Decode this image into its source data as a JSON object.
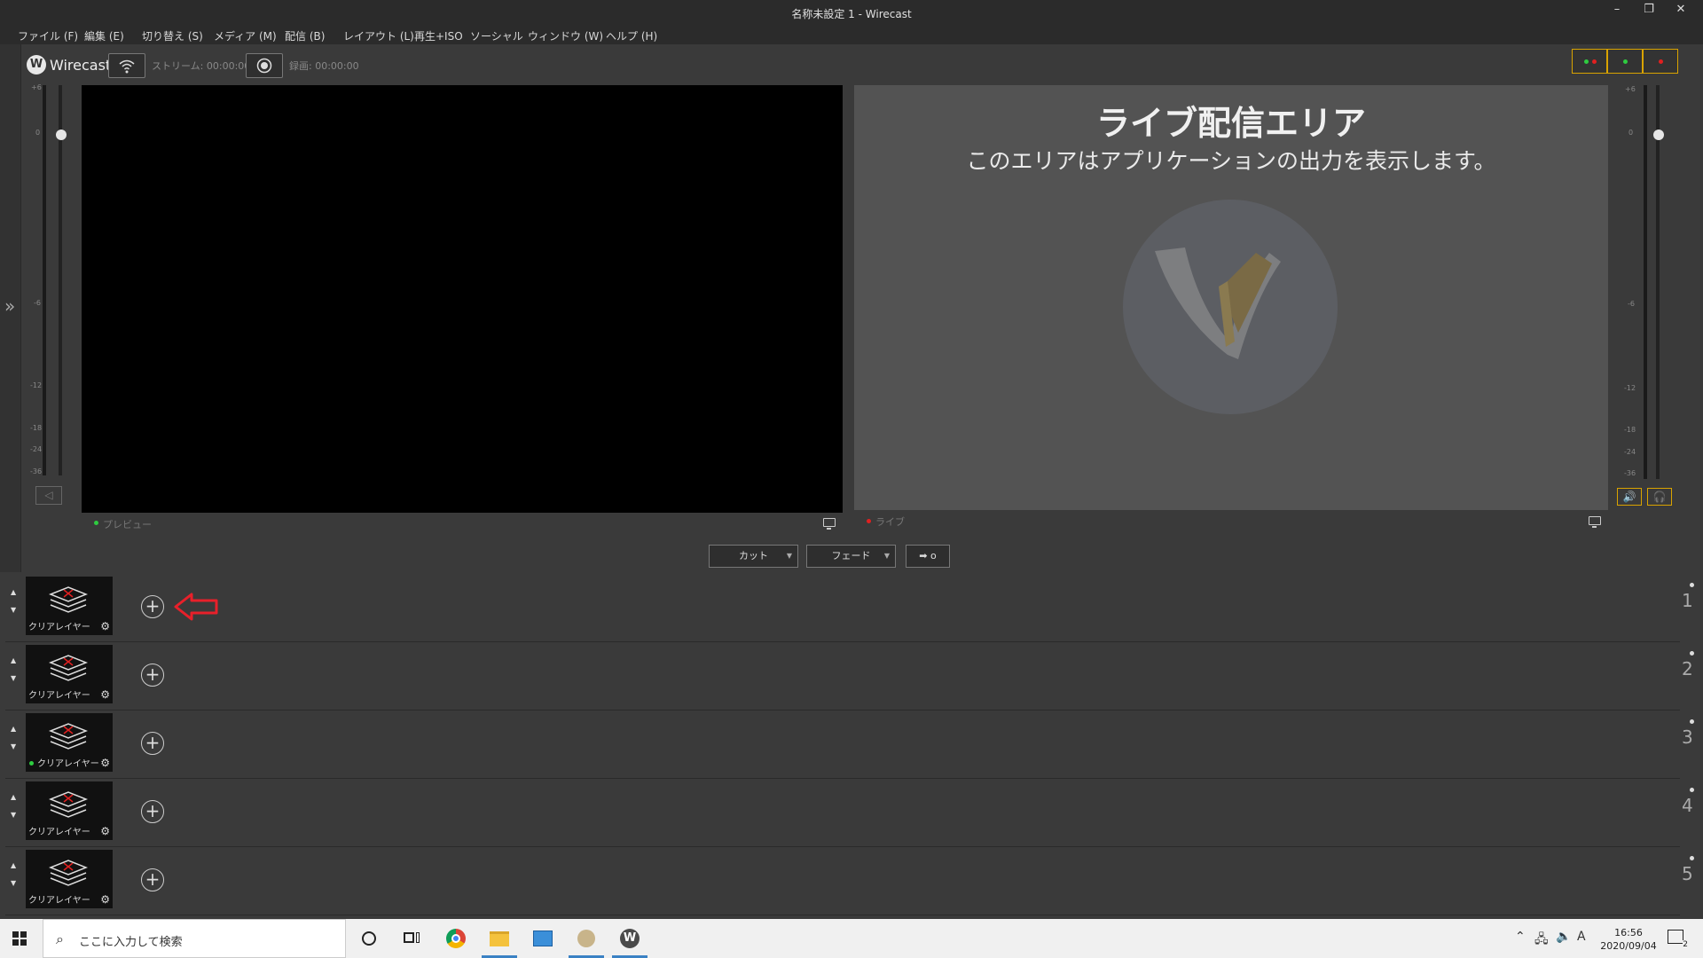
{
  "window": {
    "title": "名称未設定 1 - Wirecast",
    "minimize_glyph": "–",
    "restore_glyph": "❐",
    "close_glyph": "✕"
  },
  "menu": [
    "ファイル (F)",
    "編集 (E)",
    "切り替え (S)",
    "メディア (M)",
    "配信 (B)",
    "レイアウト (L)",
    "再生+ISO",
    "ソーシャル",
    "ウィンドウ (W)",
    "ヘルプ (H)"
  ],
  "toolbar": {
    "app_name": "Wirecast",
    "logo_glyph": "W",
    "stream_label": "ストリーム: 00:00:00",
    "record_label": "録画: 00:00:00"
  },
  "status_indicators": [
    {
      "colors": [
        "#2ecc40",
        "#e02020"
      ]
    },
    {
      "colors": [
        "#2ecc40"
      ]
    },
    {
      "colors": [
        "#e02020"
      ]
    }
  ],
  "meter_scale_left": [
    "+6",
    "0",
    "-6",
    "-12",
    "-18",
    "-24",
    "-36"
  ],
  "meter_scale_right": [
    "+6",
    "0",
    "-6",
    "-12",
    "-18",
    "-24",
    "-36"
  ],
  "preview": {
    "label": "プレビュー",
    "dot_color": "#2ecc40"
  },
  "live": {
    "label": "ライブ",
    "dot_color": "#e02020",
    "heading": "ライブ配信エリア",
    "subheading": "このエリアはアプリケーションの出力を表示します。"
  },
  "transitions": {
    "cut_label": "カット",
    "fade_label": "フェード",
    "go_label": "➡ o"
  },
  "layers": [
    {
      "name": "クリアレイヤー",
      "number": "1",
      "live": false,
      "highlight_arrow": true
    },
    {
      "name": "クリアレイヤー",
      "number": "2",
      "live": false,
      "highlight_arrow": false
    },
    {
      "name": "クリアレイヤー",
      "number": "3",
      "live": true,
      "highlight_arrow": false
    },
    {
      "name": "クリアレイヤー",
      "number": "4",
      "live": false,
      "highlight_arrow": false
    },
    {
      "name": "クリアレイヤー",
      "number": "5",
      "live": false,
      "highlight_arrow": false
    }
  ],
  "taskbar": {
    "search_placeholder": "ここに入力して検索",
    "time": "16:56",
    "date": "2020/09/04",
    "ime": "A",
    "notification_count": "2"
  },
  "colors": {
    "accent_yellow": "#d9a300",
    "live_red": "#e02020",
    "preview_green": "#2ecc40",
    "annotation_red": "#e8202a"
  }
}
